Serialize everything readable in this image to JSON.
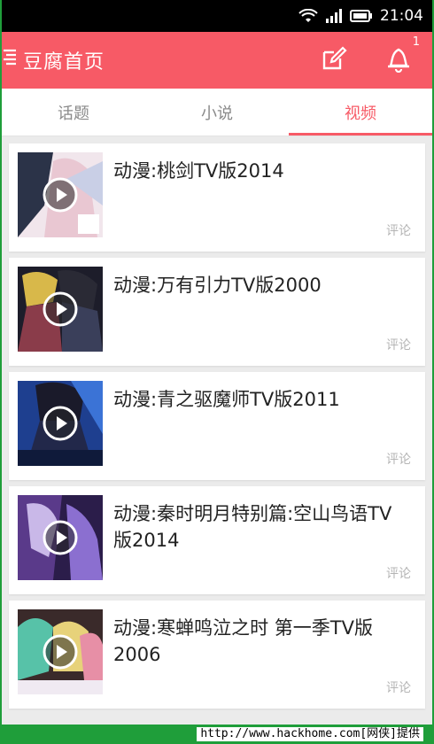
{
  "status_bar": {
    "time": "21:04"
  },
  "app_bar": {
    "title": "豆腐首页",
    "notification_count": "1",
    "icons": [
      "menu-icon",
      "edit-icon",
      "bell-icon"
    ]
  },
  "tabs": [
    {
      "label": "话题",
      "active": false
    },
    {
      "label": "小说",
      "active": false
    },
    {
      "label": "视频",
      "active": true
    }
  ],
  "videos": [
    {
      "title": "动漫:桃剑TV版2014",
      "comment_label": "评论"
    },
    {
      "title": "动漫:万有引力TV版2000",
      "comment_label": "评论"
    },
    {
      "title": "动漫:青之驱魔师TV版2011",
      "comment_label": "评论"
    },
    {
      "title": "动漫:秦时明月特别篇:空山鸟语TV版2014",
      "comment_label": "评论"
    },
    {
      "title": "动漫:寒蝉鸣泣之时 第一季TV版2006",
      "comment_label": "评论"
    }
  ],
  "watermark": "http://www.hackhome.com[网侠]提供",
  "colors": {
    "accent": "#f75a66",
    "status_bar": "#000000",
    "border": "#1f9e3a"
  }
}
